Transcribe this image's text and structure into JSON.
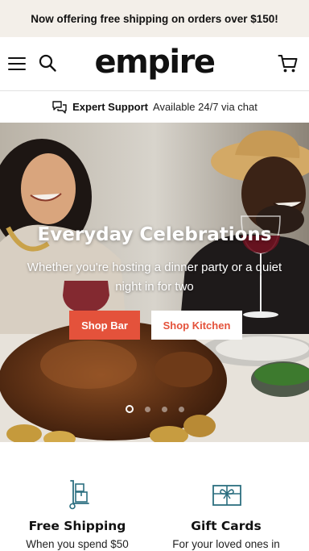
{
  "promo": {
    "text": "Now offering free shipping on orders over $150!"
  },
  "header": {
    "logo": "empire",
    "menu_icon": "hamburger-menu-icon",
    "search_icon": "search-icon",
    "cart_icon": "shopping-cart-icon"
  },
  "support": {
    "icon": "chat-bubbles-icon",
    "title": "Expert Support",
    "subtitle": "Available 24/7 via chat"
  },
  "hero": {
    "title": "Everyday Celebrations",
    "subtitle": "Whether you're hosting a dinner party or a quiet night in for two",
    "buttons": [
      {
        "label": "Shop Bar"
      },
      {
        "label": "Shop Kitchen"
      }
    ],
    "slides_total": 4,
    "active_slide": 1
  },
  "features": [
    {
      "title": "Free Shipping",
      "text": "When you spend $50",
      "icon": "hand-truck-boxes-icon"
    },
    {
      "title": "Gift Cards",
      "text": "For your loved ones in",
      "icon": "gift-card-icon"
    }
  ],
  "colors": {
    "accent": "#e4523b",
    "promo_bg": "#f3efe9",
    "icon_teal": "#2c6f80"
  }
}
